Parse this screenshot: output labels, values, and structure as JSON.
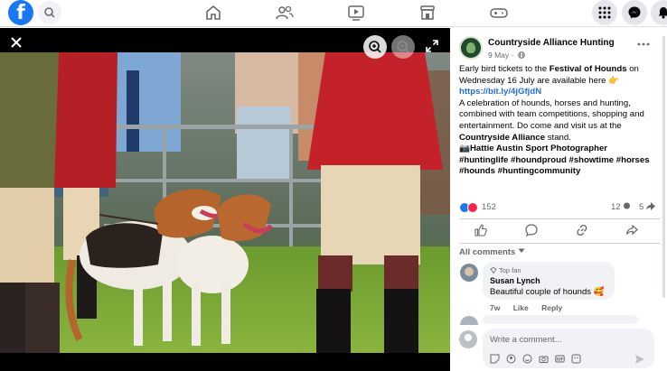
{
  "colors": {
    "brand": "#1877f2",
    "link": "#216fdb"
  },
  "topbar": {
    "logo_letter": "f",
    "icons": [
      "search-icon",
      "home-icon",
      "friends-icon",
      "watch-icon",
      "marketplace-icon",
      "gaming-icon",
      "menu-grid-icon",
      "messenger-icon",
      "bell-icon"
    ]
  },
  "post": {
    "page_name": "Countryside Alliance Hunting",
    "date": "9 May ·",
    "text": {
      "p1_a": "Early bird tickets to the ",
      "p1_bold": "Festival of Hounds",
      "p1_b": " on Wednesday 16 July are available here 👉",
      "p1_link": "https://bit.ly/4jGfjdN",
      "p2_a": "A celebration of hounds, horses and hunting, combined with team competitions, shopping and entertainment. Do come and visit us at the ",
      "p2_bold": "Countryside Alliance",
      "p2_b": " stand.",
      "p3_credit": "📷Hattie Austin Sport Photographer",
      "p3_tags": "#huntinglife #houndproud #showtime #horses #hounds #huntingcommunity"
    },
    "reactions_count": "152",
    "comments_count": "12",
    "shares_count": "5"
  },
  "comments": {
    "filter_label": "All comments",
    "items": [
      {
        "badge": "Top fan",
        "author": "Susan Lynch",
        "text": "Beautiful couple of hounds 🥰",
        "time": "7w",
        "like": "Like",
        "reply": "Reply"
      }
    ],
    "composer_placeholder": "Write a comment..."
  }
}
